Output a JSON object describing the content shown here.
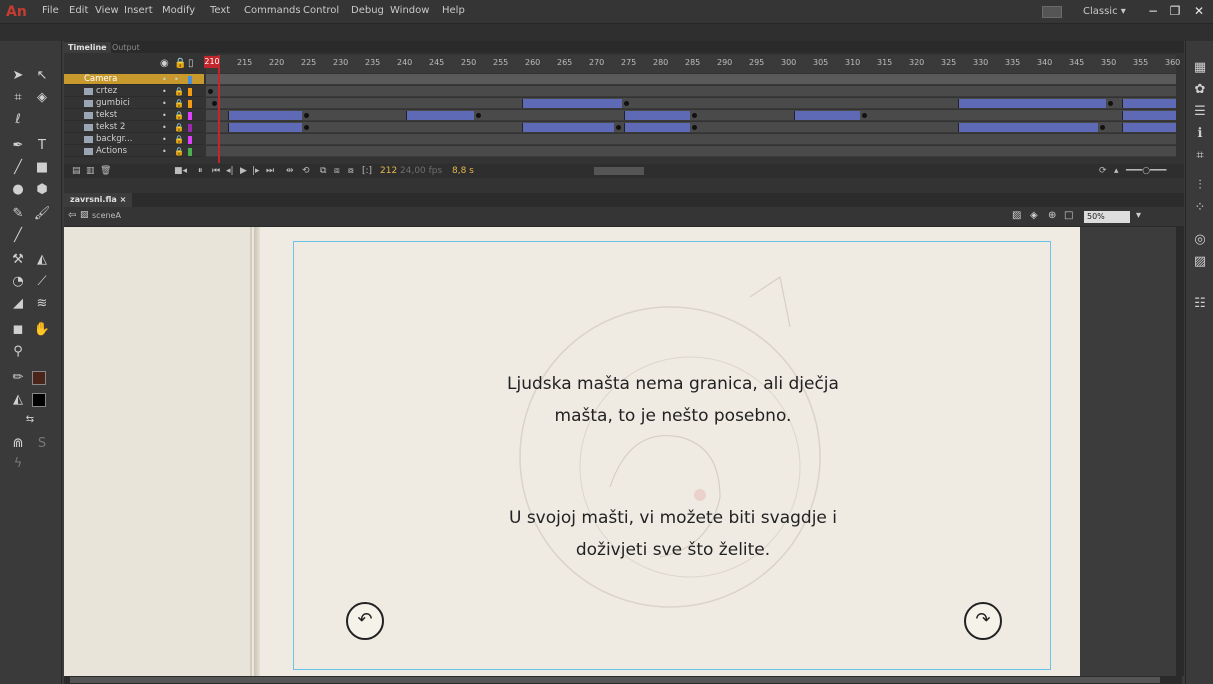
{
  "app": {
    "logo": "An",
    "menu": [
      "File",
      "Edit",
      "View",
      "Insert",
      "Modify",
      "Text",
      "Commands",
      "Control",
      "Debug",
      "Window",
      "Help"
    ],
    "workspace": "Classic",
    "window_controls": [
      "−",
      "❐",
      "✕"
    ]
  },
  "timeline": {
    "tabs": [
      "Timeline",
      "Output"
    ],
    "current_frame": "210",
    "ruler": [
      "215",
      "220",
      "225",
      "230",
      "235",
      "240",
      "245",
      "250",
      "255",
      "260",
      "265",
      "270",
      "275",
      "280",
      "285",
      "290",
      "295",
      "300",
      "305",
      "310",
      "315",
      "320",
      "325",
      "330",
      "335",
      "340",
      "345",
      "350",
      "355",
      "360"
    ],
    "layers": [
      {
        "name": "Camera",
        "color": "#4a90d9"
      },
      {
        "name": "crtez",
        "color": "#f39c12"
      },
      {
        "name": "gumbici",
        "color": "#f39c12"
      },
      {
        "name": "tekst",
        "color": "#e040fb"
      },
      {
        "name": "tekst 2",
        "color": "#9c27b0"
      },
      {
        "name": "backgr...",
        "color": "#e040fb"
      },
      {
        "name": "Actions",
        "color": "#4caf50"
      }
    ],
    "status": {
      "frame": "212",
      "fps": "24,00 fps",
      "time": "8,8 s"
    }
  },
  "document": {
    "tab": "zavrsni.fla",
    "scene": "sceneA",
    "zoom": "50%"
  },
  "stage": {
    "paragraph1_line1": "Ljudska mašta nema granica, ali dječja",
    "paragraph1_line2": "mašta, to je nešto posebno.",
    "paragraph2_line1": "U svojoj mašti, vi možete biti svagdje i",
    "paragraph2_line2": "doživjeti sve što želite."
  },
  "colors": {
    "accent_playhead": "#c0262b",
    "tween": "#5e6ab5",
    "stage_frame": "#6cc3e8"
  }
}
